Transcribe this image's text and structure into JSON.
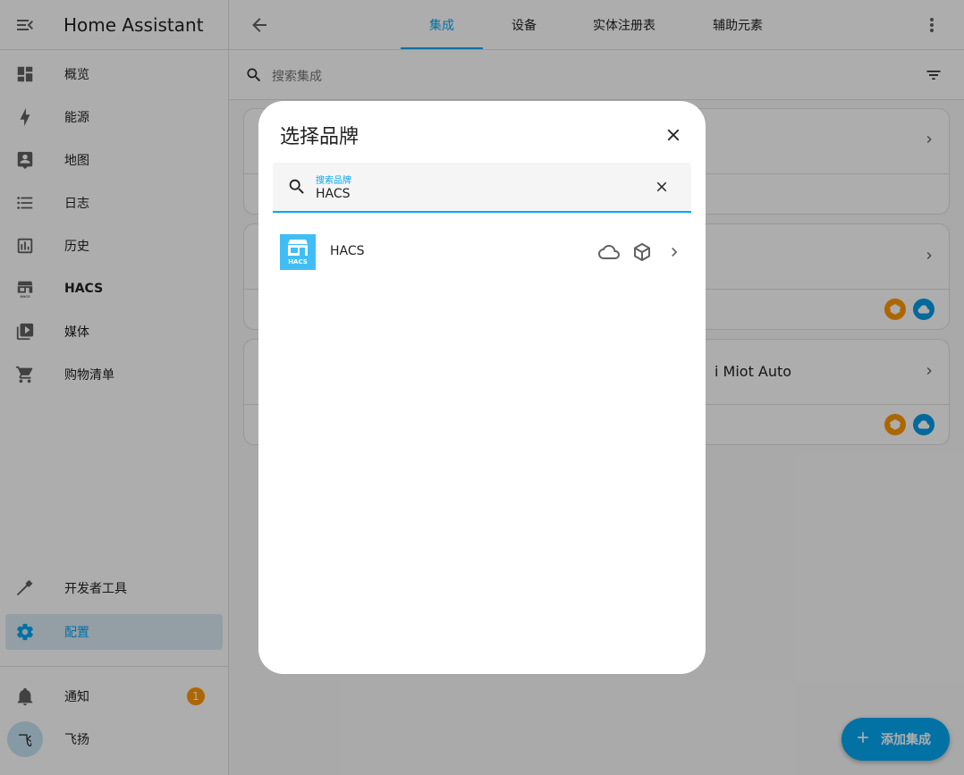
{
  "sidebar": {
    "title": "Home Assistant",
    "menu_icon": "menu-open-icon",
    "items": [
      {
        "label": "概览",
        "icon": "view-dashboard-icon"
      },
      {
        "label": "能源",
        "icon": "lightning-bolt-icon"
      },
      {
        "label": "地图",
        "icon": "account-box-icon"
      },
      {
        "label": "日志",
        "icon": "format-list-bulleted-icon"
      },
      {
        "label": "历史",
        "icon": "chart-box-icon"
      },
      {
        "label": "HACS",
        "icon": "hacs-icon"
      },
      {
        "label": "媒体",
        "icon": "play-box-multiple-icon"
      },
      {
        "label": "购物清单",
        "icon": "cart-icon"
      }
    ],
    "bottom_items": [
      {
        "label": "开发者工具",
        "icon": "hammer-icon"
      },
      {
        "label": "配置",
        "icon": "cog-icon",
        "active": true
      }
    ],
    "notifications": {
      "label": "通知",
      "count": "1"
    },
    "user": {
      "name": "飞扬",
      "initial": "飞"
    }
  },
  "topbar": {
    "tabs": [
      {
        "label": "集成",
        "active": true
      },
      {
        "label": "设备"
      },
      {
        "label": "实体注册表"
      },
      {
        "label": "辅助元素"
      }
    ]
  },
  "search": {
    "placeholder": "搜索集成"
  },
  "cards": [
    {
      "title": ""
    },
    {
      "title": ""
    },
    {
      "title": "i Miot Auto"
    }
  ],
  "fab": {
    "label": "添加集成"
  },
  "dialog": {
    "title": "选择品牌",
    "search_label": "搜索品牌",
    "search_value": "HACS",
    "results": [
      {
        "name": "HACS",
        "logo_text": "HACS",
        "icons": [
          "cloud-outline-icon",
          "package-variant-icon"
        ]
      }
    ]
  },
  "colors": {
    "accent": "#03a9f4",
    "hacs_blue": "#41bdf5",
    "badge_orange": "#ff9800",
    "active_bg": "#dbe9f3"
  }
}
